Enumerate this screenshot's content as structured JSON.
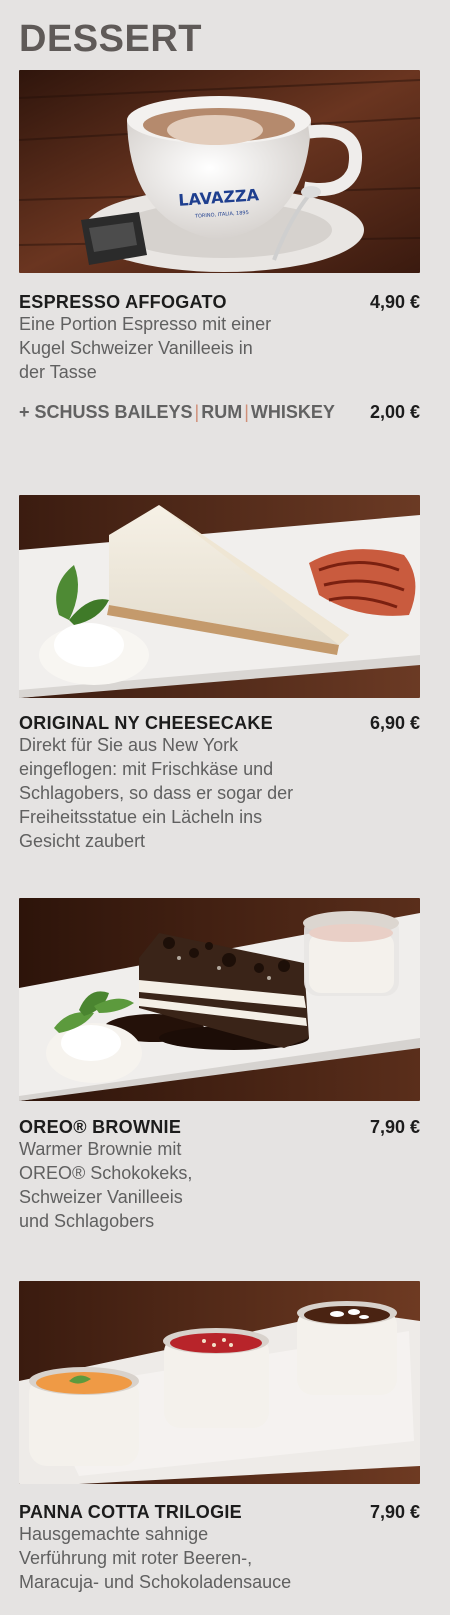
{
  "menu": {
    "title": "DESSERT",
    "items": [
      {
        "name": "ESPRESSO AFFOGATO",
        "price": "4,90 €",
        "description_lines": [
          "Eine Portion Espresso mit einer",
          "Kugel Schweizer Vanilleeis in",
          "der Tasse"
        ],
        "extra": {
          "prefix": "+ SCHUSS BAILEYS",
          "separator": "|",
          "option_2": "RUM",
          "option_3": "WHISKEY",
          "price": "2,00 €"
        },
        "photo_branding": {
          "logo_text": "LAVAZZA",
          "logo_subtext": "TORINO, ITALIA, 1895"
        }
      },
      {
        "name": "ORIGINAL NY CHEESECAKE",
        "price": "6,90 €",
        "description_lines": [
          "Direkt für Sie aus New York",
          "eingeflogen: mit Frischkäse und",
          "Schlagobers, so dass er sogar der",
          "Freiheitsstatue ein Lächeln ins",
          "Gesicht zaubert"
        ]
      },
      {
        "name": "OREO® BROWNIE",
        "price": "7,90 €",
        "description_lines": [
          "Warmer Brownie mit",
          "OREO® Schokokeks,",
          "Schweizer Vanilleeis",
          "und Schlagobers"
        ]
      },
      {
        "name": "PANNA COTTA TRILOGIE",
        "price": "7,90 €",
        "description_lines": [
          "Hausgemachte sahnige",
          "Verführung mit roter Beeren-,",
          "Maracuja- und Schokoladensauce"
        ]
      }
    ]
  },
  "colors": {
    "background": "#e5e3e2",
    "title": "#5f5a58",
    "text": "#606060",
    "heading": "#1c1c1c",
    "separator": "#d08f78",
    "wood": "#4a2618"
  }
}
